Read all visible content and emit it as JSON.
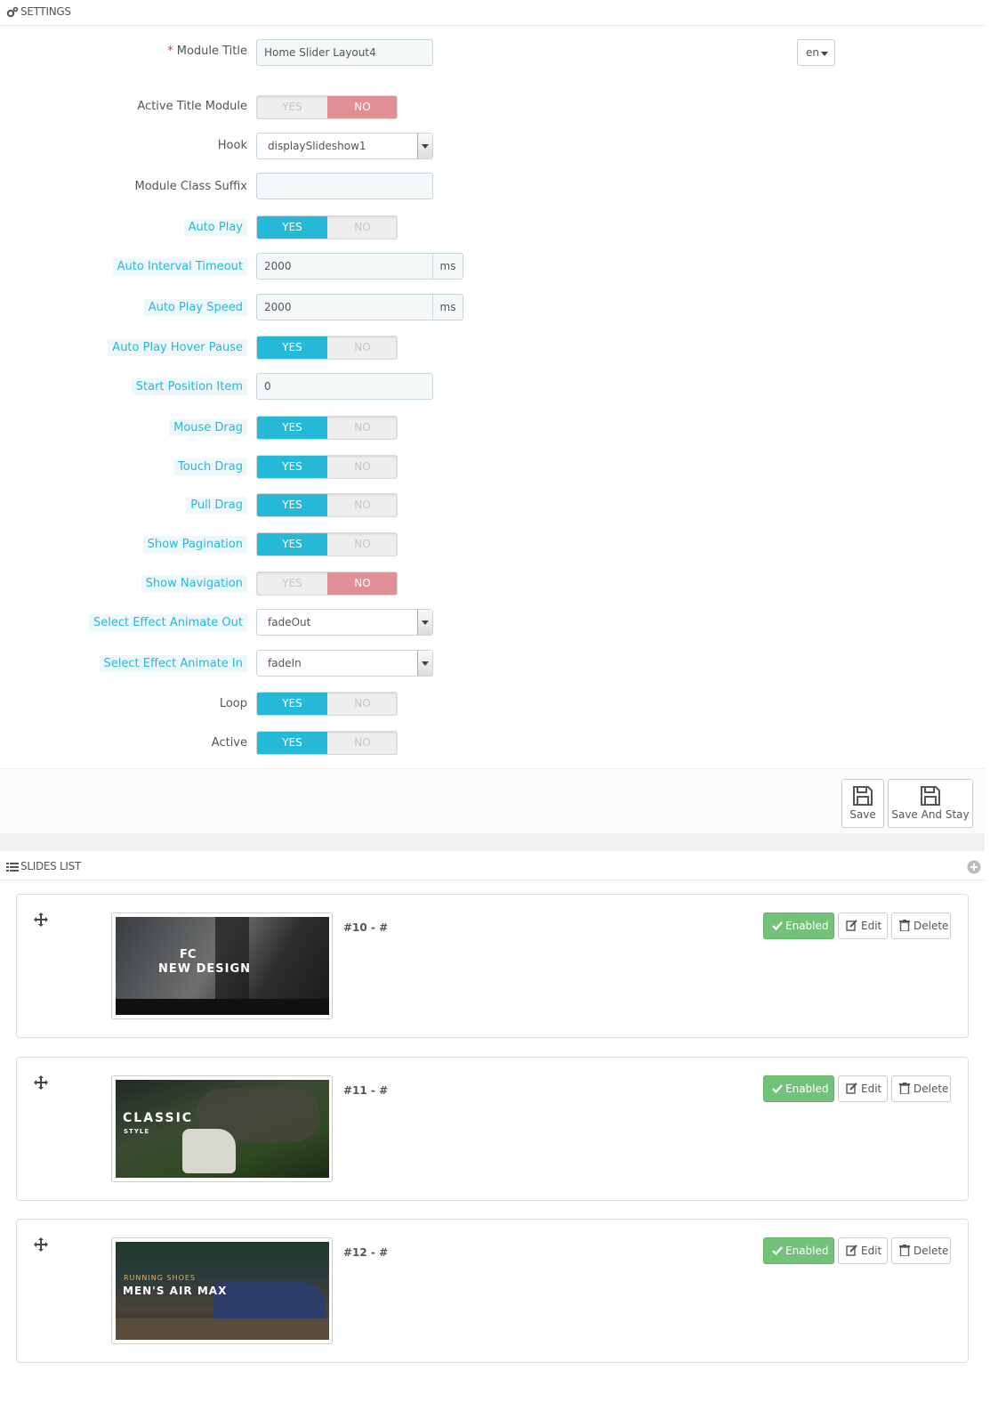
{
  "settings": {
    "heading": "SETTINGS",
    "lang": "en",
    "fields": {
      "module_title": {
        "label": "Module Title",
        "required_mark": "*",
        "value": "Home Slider Layout4"
      },
      "active_title_module": {
        "label": "Active Title Module",
        "state": "no"
      },
      "hook": {
        "label": "Hook",
        "value": "displaySlideshow1"
      },
      "module_class_suffix": {
        "label": "Module Class Suffix",
        "value": ""
      },
      "auto_play": {
        "label": "Auto Play",
        "state": "yes"
      },
      "auto_interval_timeout": {
        "label": "Auto Interval Timeout",
        "value": "2000",
        "unit": "ms"
      },
      "auto_play_speed": {
        "label": "Auto Play Speed",
        "value": "2000",
        "unit": "ms"
      },
      "auto_play_hover_pause": {
        "label": "Auto Play Hover Pause",
        "state": "yes"
      },
      "start_position_item": {
        "label": "Start Position Item",
        "value": "0"
      },
      "mouse_drag": {
        "label": "Mouse Drag",
        "state": "yes"
      },
      "touch_drag": {
        "label": "Touch Drag",
        "state": "yes"
      },
      "pull_drag": {
        "label": "Pull Drag",
        "state": "yes"
      },
      "show_pagination": {
        "label": "Show Pagination",
        "state": "yes"
      },
      "show_navigation": {
        "label": "Show Navigation",
        "state": "no"
      },
      "select_effect_animate_out": {
        "label": "Select Effect Animate Out",
        "value": "fadeOut"
      },
      "select_effect_animate_in": {
        "label": "Select Effect Animate In",
        "value": "fadeIn"
      },
      "loop": {
        "label": "Loop",
        "state": "yes"
      },
      "active": {
        "label": "Active",
        "state": "yes"
      }
    },
    "switch_labels": {
      "yes": "YES",
      "no": "NO"
    },
    "footer": {
      "save": "Save",
      "save_and_stay": "Save And Stay"
    }
  },
  "slides_list": {
    "heading": "SLIDES LIST",
    "items": [
      {
        "id_text": "#10 - #",
        "status": "Enabled",
        "edit": "Edit",
        "delete": "Delete",
        "image_lines": [
          "FC",
          "NEW DESIGN"
        ]
      },
      {
        "id_text": "#11 - #",
        "status": "Enabled",
        "edit": "Edit",
        "delete": "Delete",
        "image_lines": [
          "CLASSIC",
          "STYLE"
        ]
      },
      {
        "id_text": "#12 - #",
        "status": "Enabled",
        "edit": "Edit",
        "delete": "Delete",
        "image_lines": [
          "RUNNING SHOES",
          "MEN'S AIR MAX"
        ]
      }
    ]
  },
  "colors": {
    "accent": "#25b9d7",
    "no_active": "#e08f95",
    "enabled": "#72c279"
  }
}
